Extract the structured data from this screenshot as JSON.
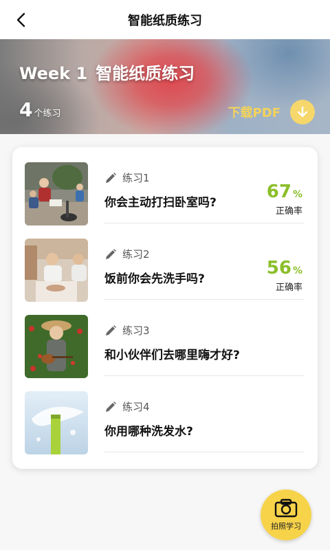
{
  "nav": {
    "title": "智能纸质练习",
    "back_icon": "chevron-left-icon"
  },
  "hero": {
    "week": "Week 1",
    "subtitle": "智能纸质练习",
    "count_num": "4",
    "count_unit": "个练习",
    "pdf_label": "下载PDF",
    "pdf_icon": "download-icon"
  },
  "exercises": [
    {
      "label": "练习1",
      "question": "你会主动打扫卧室吗?",
      "score": "67",
      "score_unit": "%",
      "score_label": "正确率"
    },
    {
      "label": "练习2",
      "question": "饭前你会先洗手吗?",
      "score": "56",
      "score_unit": "%",
      "score_label": "正确率"
    },
    {
      "label": "练习3",
      "question": "和小伙伴们去哪里嗨才好?"
    },
    {
      "label": "练习4",
      "question": "你用哪种洗发水?"
    }
  ],
  "fab": {
    "label": "拍照学习",
    "icon": "camera-icon"
  },
  "colors": {
    "accent_yellow": "#f7d34a",
    "score_green": "#8bbf2a",
    "pdf_yellow": "#f3d35a"
  }
}
